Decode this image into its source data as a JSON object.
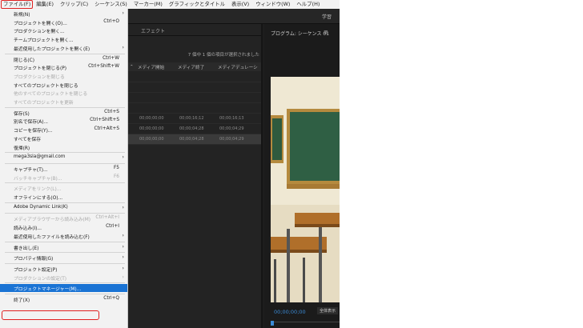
{
  "menubar": {
    "items": [
      "ファイル(F)",
      "編集(E)",
      "クリップ(C)",
      "シーケンス(S)",
      "マーカー(M)",
      "グラフィックとタイトル",
      "表示(V)",
      "ウィンドウ(W)",
      "ヘルプ(H)"
    ]
  },
  "toolbar": {
    "workspace": "学習"
  },
  "project_panel": {
    "tab": "エフェクト",
    "selection_info": "7 個中 1 個の項目が選択されました",
    "columns": [
      "メディア開始",
      "メディア終了",
      "メディアデュレーシ"
    ],
    "rows": [
      {
        "start": "00;00;00;00",
        "end": "00;00;16;12",
        "duration": "00;00;16;13",
        "selected": false
      },
      {
        "start": "00;00;00;00",
        "end": "00;00;04;28",
        "duration": "00;00;04;29",
        "selected": false
      },
      {
        "start": "00;00;00;00",
        "end": "00;00;04;28",
        "duration": "00;00;04;29",
        "selected": true
      }
    ]
  },
  "program": {
    "title": "プログラム: シーケンス 01",
    "menu_glyph": "≡",
    "timecode": "00;00;00;00",
    "fit": "全体表示"
  },
  "file_menu": {
    "items": [
      {
        "label": "新規(N)",
        "shortcut": "",
        "submenu": true,
        "disabled": false
      },
      {
        "label": "プロジェクトを開く(O)...",
        "shortcut": "Ctrl+O",
        "submenu": false,
        "disabled": false
      },
      {
        "label": "プロダクションを開く...",
        "shortcut": "",
        "submenu": false,
        "disabled": false
      },
      {
        "label": "チームプロジェクトを開く...",
        "shortcut": "",
        "submenu": false,
        "disabled": false
      },
      {
        "label": "最近使用したプロジェクトを開く(E)",
        "shortcut": "",
        "submenu": true,
        "disabled": false
      },
      {
        "separator": true
      },
      {
        "label": "閉じる(C)",
        "shortcut": "Ctrl+W",
        "submenu": false,
        "disabled": false
      },
      {
        "label": "プロジェクトを閉じる(P)",
        "shortcut": "Ctrl+Shift+W",
        "submenu": false,
        "disabled": false
      },
      {
        "label": "プロダクションを閉じる",
        "shortcut": "",
        "submenu": false,
        "disabled": true
      },
      {
        "label": "すべてのプロジェクトを閉じる",
        "shortcut": "",
        "submenu": false,
        "disabled": false
      },
      {
        "label": "他のすべてのプロジェクトを閉じる",
        "shortcut": "",
        "submenu": false,
        "disabled": true
      },
      {
        "label": "すべてのプロジェクトを更新",
        "shortcut": "",
        "submenu": false,
        "disabled": true
      },
      {
        "separator": true
      },
      {
        "label": "保存(S)",
        "shortcut": "Ctrl+S",
        "submenu": false,
        "disabled": false
      },
      {
        "label": "別名で保存(A)...",
        "shortcut": "Ctrl+Shift+S",
        "submenu": false,
        "disabled": false
      },
      {
        "label": "コピーを保存(Y)...",
        "shortcut": "Ctrl+Alt+S",
        "submenu": false,
        "disabled": false
      },
      {
        "label": "すべてを保存",
        "shortcut": "",
        "submenu": false,
        "disabled": false
      },
      {
        "label": "復帰(R)",
        "shortcut": "",
        "submenu": false,
        "disabled": false
      },
      {
        "separator": true
      },
      {
        "label": "mega3sla@gmail.com",
        "shortcut": "",
        "submenu": true,
        "disabled": false
      },
      {
        "separator": true
      },
      {
        "label": "キャプチャ(T)...",
        "shortcut": "F5",
        "submenu": false,
        "disabled": false
      },
      {
        "label": "バッチキャプチャ(B)...",
        "shortcut": "F6",
        "submenu": false,
        "disabled": true
      },
      {
        "separator": true
      },
      {
        "label": "メディアをリンク(L)...",
        "shortcut": "",
        "submenu": false,
        "disabled": true
      },
      {
        "label": "オフラインにする(O)...",
        "shortcut": "",
        "submenu": false,
        "disabled": false
      },
      {
        "separator": true
      },
      {
        "label": "Adobe Dynamic Link(K)",
        "shortcut": "",
        "submenu": true,
        "disabled": false
      },
      {
        "separator": true
      },
      {
        "label": "メディアブラウザーから読み込み(M)",
        "shortcut": "Ctrl+Alt+I",
        "submenu": false,
        "disabled": true
      },
      {
        "label": "読み込み(I)...",
        "shortcut": "Ctrl+I",
        "submenu": false,
        "disabled": false
      },
      {
        "label": "最近使用したファイルを読み込む(F)",
        "shortcut": "",
        "submenu": true,
        "disabled": false
      },
      {
        "separator": true
      },
      {
        "label": "書き出し(E)",
        "shortcut": "",
        "submenu": true,
        "disabled": false
      },
      {
        "separator": true
      },
      {
        "label": "プロパティ情報(G)",
        "shortcut": "",
        "submenu": true,
        "disabled": false
      },
      {
        "separator": true
      },
      {
        "label": "プロジェクト設定(P)",
        "shortcut": "",
        "submenu": true,
        "disabled": false
      },
      {
        "label": "プロダクションの設定(T)",
        "shortcut": "",
        "submenu": true,
        "disabled": true
      },
      {
        "separator": true
      },
      {
        "label": "プロジェクトマネージャー(M)...",
        "shortcut": "",
        "submenu": false,
        "disabled": false,
        "highlighted": true
      },
      {
        "separator": true
      },
      {
        "label": "終了(X)",
        "shortcut": "Ctrl+Q",
        "submenu": false,
        "disabled": false
      }
    ]
  },
  "colors": {
    "highlight": "#1a73d4",
    "annotation": "#e02020",
    "timecode": "#3b8bd6"
  }
}
